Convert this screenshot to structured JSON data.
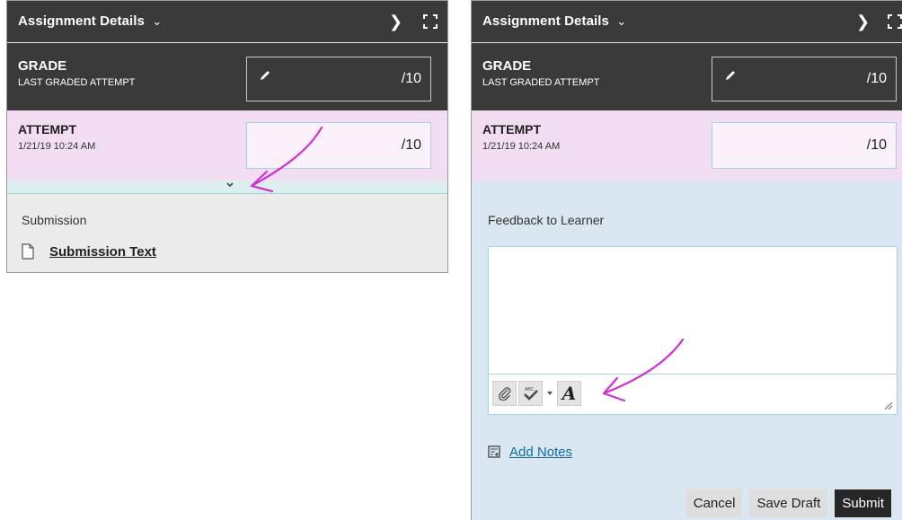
{
  "left_panel": {
    "header": {
      "title": "Assignment Details",
      "title_chevron": "chevron-down-icon",
      "next_icon": "chevron-right-icon",
      "expand_icon": "fullscreen-icon"
    },
    "grade": {
      "label": "GRADE",
      "sublabel": "LAST GRADED ATTEMPT",
      "score": "/10"
    },
    "attempt": {
      "label": "ATTEMPT",
      "date": "1/21/19 10:24 AM",
      "score": "/10"
    },
    "submission": {
      "label": "Submission",
      "link": "Submission Text"
    }
  },
  "right_panel": {
    "header": {
      "title": "Assignment Details"
    },
    "grade": {
      "label": "GRADE",
      "sublabel": "LAST GRADED ATTEMPT",
      "score": "/10"
    },
    "attempt": {
      "label": "ATTEMPT",
      "date": "1/21/19 10:24 AM",
      "score": "/10"
    },
    "feedback": {
      "label": "Feedback to Learner",
      "value": ""
    },
    "notes_link": "Add Notes",
    "buttons": {
      "cancel": "Cancel",
      "save_draft": "Save Draft",
      "submit": "Submit"
    }
  },
  "colors": {
    "header_bg": "#3a3a3a",
    "attempt_bg": "#f2ddf2",
    "right_panel_bg": "#d9e8f0",
    "link": "#1669a8",
    "annotation_arrow": "#d12fd6"
  }
}
